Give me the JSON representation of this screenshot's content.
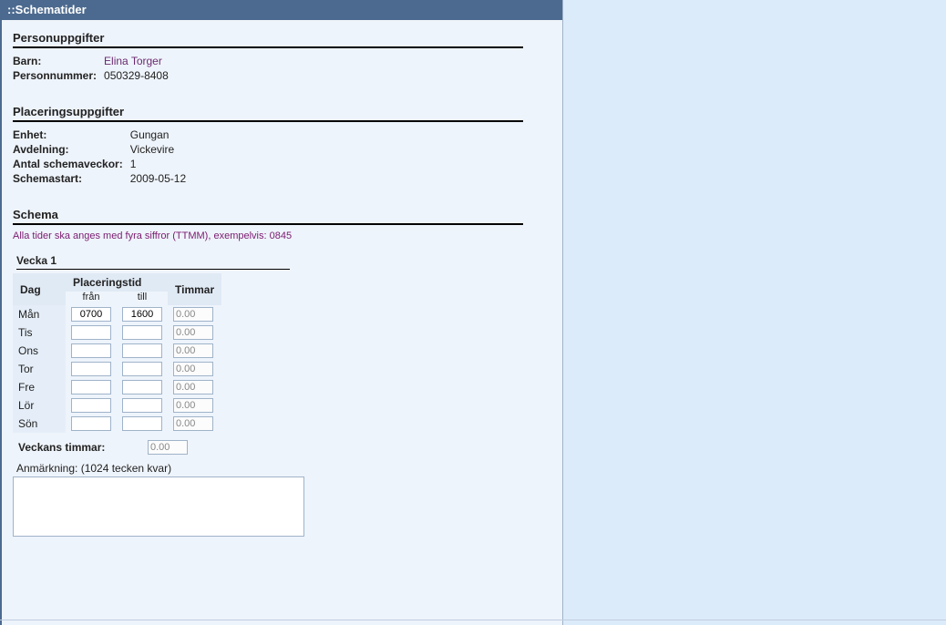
{
  "header_title": "::Schematider",
  "person": {
    "section_title": "Personuppgifter",
    "fields": {
      "barn_label": "Barn:",
      "barn_value": "Elina Torger",
      "pnr_label": "Personnummer:",
      "pnr_value": "050329-8408"
    }
  },
  "placement": {
    "section_title": "Placeringsuppgifter",
    "fields": {
      "enhet_label": "Enhet:",
      "enhet_value": "Gungan",
      "avd_label": "Avdelning:",
      "avd_value": "Vickevire",
      "weeks_label": "Antal schemaveckor:",
      "weeks_value": "1",
      "start_label": "Schemastart:",
      "start_value": "2009-05-12"
    }
  },
  "schema": {
    "section_title": "Schema",
    "hint": "Alla tider ska anges med fyra siffror (TTMM), exempelvis: 0845",
    "week_label": "Vecka 1",
    "columns": {
      "day": "Dag",
      "placeringstid": "Placeringstid",
      "from": "från",
      "till": "till",
      "timmar": "Timmar"
    },
    "rows": [
      {
        "day": "Mån",
        "from": "0700",
        "till": "1600",
        "hours": "0.00"
      },
      {
        "day": "Tis",
        "from": "",
        "till": "",
        "hours": "0.00"
      },
      {
        "day": "Ons",
        "from": "",
        "till": "",
        "hours": "0.00"
      },
      {
        "day": "Tor",
        "from": "",
        "till": "",
        "hours": "0.00"
      },
      {
        "day": "Fre",
        "from": "",
        "till": "",
        "hours": "0.00"
      },
      {
        "day": "Lör",
        "from": "",
        "till": "",
        "hours": "0.00"
      },
      {
        "day": "Sön",
        "from": "",
        "till": "",
        "hours": "0.00"
      }
    ],
    "total_label": "Veckans timmar:",
    "total_value": "0.00",
    "note_label": "Anmärkning: (1024 tecken kvar)",
    "note_value": ""
  }
}
